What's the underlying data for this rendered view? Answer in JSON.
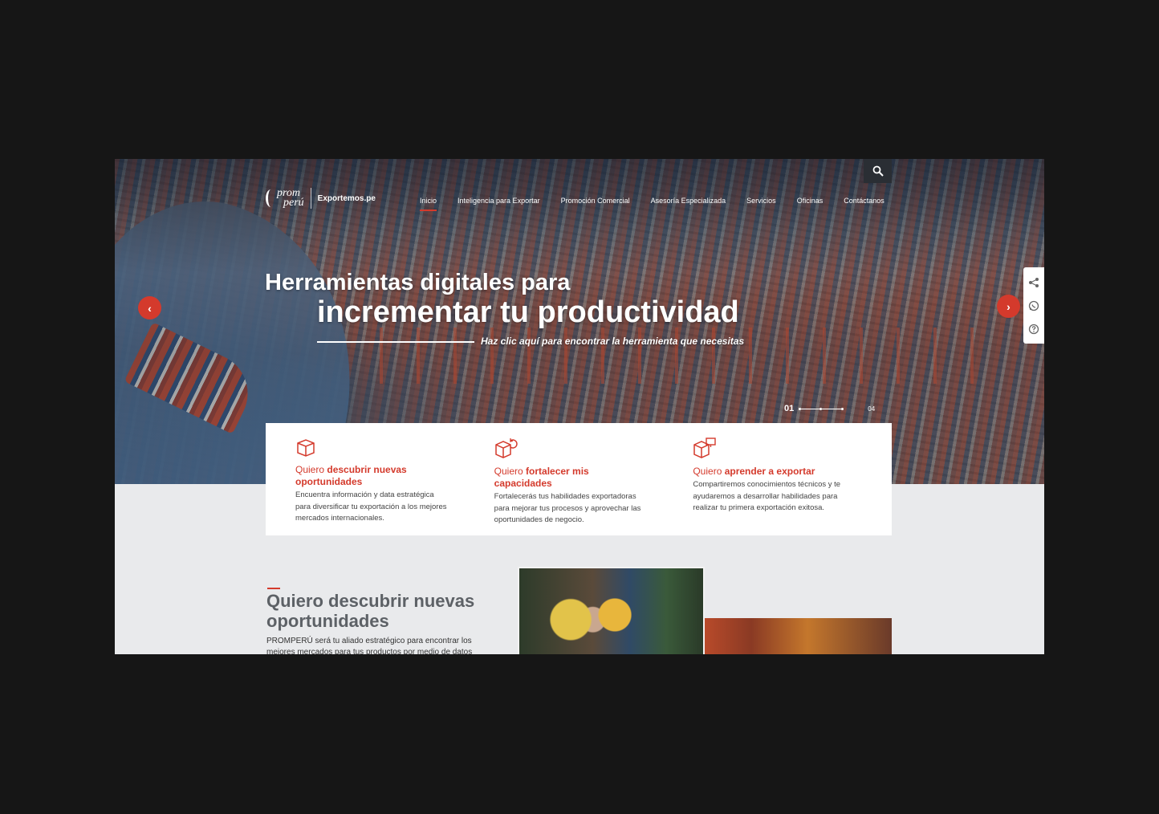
{
  "header": {
    "logo_top": "prom",
    "logo_bottom": "perú",
    "site": "Exportemos.pe",
    "nav": [
      "Inicio",
      "Inteligencia para Exportar",
      "Promoción Comercial",
      "Asesoría Especializada",
      "Servicios",
      "Oficinas",
      "Contáctanos"
    ],
    "active": "Inicio"
  },
  "hero": {
    "line1": "Herramientas digitales para",
    "line2": "incrementar tu productividad",
    "cta": "Haz clic aquí para encontrar la herramienta que necesitas",
    "slide_current": "01",
    "slide_total": "04",
    "prev": "‹",
    "next": "›"
  },
  "cards": [
    {
      "icon": "box-icon",
      "pre": "Quiero ",
      "bold": "descubrir nuevas oportunidades",
      "desc": "Encuentra información y data estratégica para diversificar tu exportación a los mejores mercados internacionales."
    },
    {
      "icon": "box-refresh-icon",
      "pre": "Quiero ",
      "bold": "fortalecer mis capacidades",
      "desc": "Fortalecerás tus habilidades exportadoras para mejorar tus procesos y aprovechar las oportunidades de negocio."
    },
    {
      "icon": "box-screen-icon",
      "pre": "Quiero ",
      "bold": "aprender a exportar",
      "desc": "Compartiremos conocimientos técnicos y te ayudaremos a desarrollar habilidades para realizar tu primera exportación exitosa."
    }
  ],
  "section": {
    "title": "Quiero descubrir nuevas oportunidades",
    "desc": "PROMPERÚ será tu aliado estratégico para encontrar los mejores mercados para tus productos por medio de datos"
  },
  "colors": {
    "accent": "#d43a2c",
    "text_dark": "#5d6166"
  }
}
